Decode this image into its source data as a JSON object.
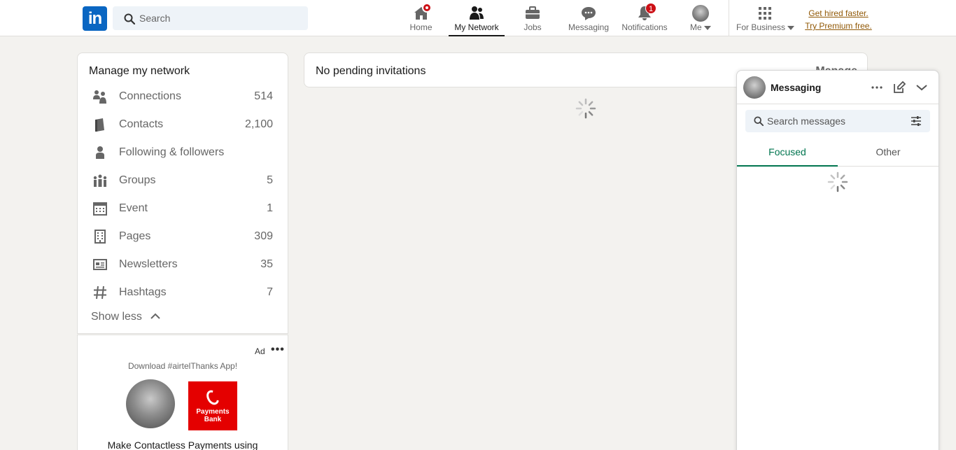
{
  "nav": {
    "logo_text": "in",
    "search_placeholder": "Search",
    "items": [
      {
        "label": "Home"
      },
      {
        "label": "My Network"
      },
      {
        "label": "Jobs"
      },
      {
        "label": "Messaging"
      },
      {
        "label": "Notifications",
        "badge": "1"
      },
      {
        "label": "Me"
      },
      {
        "label": "For Business"
      }
    ],
    "premium_line1": "Get hired faster.",
    "premium_line2": "Try Premium free."
  },
  "network": {
    "title": "Manage my network",
    "rows": [
      {
        "label": "Connections",
        "count": "514",
        "icon": "connections-icon"
      },
      {
        "label": "Contacts",
        "count": "2,100",
        "icon": "contacts-icon"
      },
      {
        "label": "Following & followers",
        "count": "",
        "icon": "following-icon"
      },
      {
        "label": "Groups",
        "count": "5",
        "icon": "groups-icon"
      },
      {
        "label": "Event",
        "count": "1",
        "icon": "event-icon"
      },
      {
        "label": "Pages",
        "count": "309",
        "icon": "pages-icon"
      },
      {
        "label": "Newsletters",
        "count": "35",
        "icon": "newsletters-icon"
      },
      {
        "label": "Hashtags",
        "count": "7",
        "icon": "hashtag-icon"
      }
    ],
    "show_less": "Show less"
  },
  "ad": {
    "label": "Ad",
    "text": "Download #airtelThanks App!",
    "brand_line1": "Payments",
    "brand_line2": "Bank",
    "headline": "Make Contactless Payments using"
  },
  "main": {
    "invitations_text": "No pending invitations",
    "manage_label": "Manage"
  },
  "messaging": {
    "title": "Messaging",
    "search_placeholder": "Search messages",
    "tabs": [
      "Focused",
      "Other"
    ]
  },
  "colors": {
    "brand": "#0a66c2",
    "badge": "#cc1016",
    "focused_tab": "#01754f",
    "premium_link": "#915907"
  }
}
